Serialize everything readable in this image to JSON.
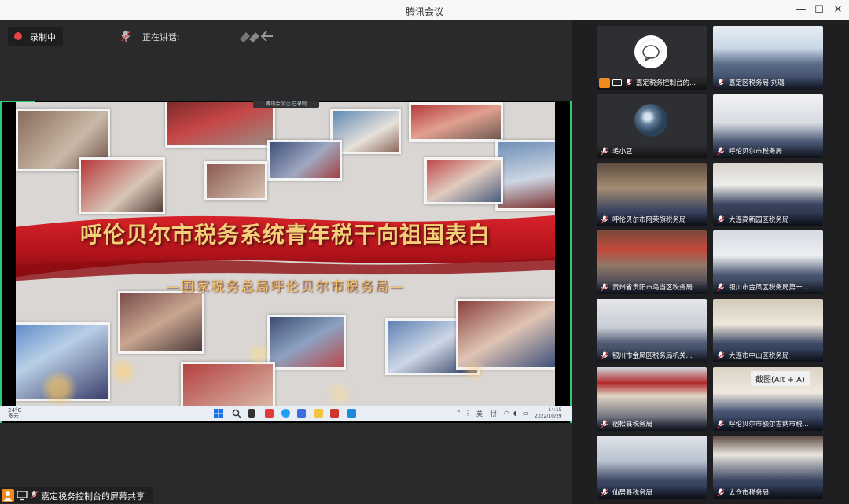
{
  "window": {
    "title": "腾讯会议"
  },
  "toolbar": {
    "recording_label": "录制中",
    "speaking_label": "正在讲话:"
  },
  "share": {
    "banner_title": "呼伦贝尔市税务系统青年税干向祖国表白",
    "banner_subtitle": "—国家税务总局呼伦贝尔市税务局—",
    "remote_bar_text": "腾讯会议 ▢ 已录制",
    "taskbar": {
      "weather_temp": "24°C",
      "weather_text": "多云",
      "ime_lang": "英",
      "ime_mode": "拼",
      "clock_time": "14:15",
      "clock_date": "2022/10/29"
    }
  },
  "bottom_bar": {
    "share_label": "嘉定税务控制台的屏幕共享"
  },
  "participants": [
    {
      "name": "嘉定税务控制台的...",
      "type": "avatar"
    },
    {
      "name": "嘉定区税务局 刘璐",
      "type": "room"
    },
    {
      "name": "毛小豆",
      "type": "avatar"
    },
    {
      "name": "呼伦贝尔市税务局",
      "type": "room"
    },
    {
      "name": "呼伦贝尔市阿荣旗税务局",
      "type": "room"
    },
    {
      "name": "大连高新园区税务局",
      "type": "room"
    },
    {
      "name": "贵州省贵阳市乌当区税务局",
      "type": "room"
    },
    {
      "name": "银川市金凤区税务局第一...",
      "type": "room"
    },
    {
      "name": "银川市金凤区税务局机关...",
      "type": "room"
    },
    {
      "name": "大连市中山区税务局",
      "type": "room"
    },
    {
      "name": "宿松县税务局",
      "type": "room"
    },
    {
      "name": "呼伦贝尔市额尔古纳市税...",
      "type": "room"
    },
    {
      "name": "仙居县税务局",
      "type": "room"
    },
    {
      "name": "太仓市税务局",
      "type": "room"
    }
  ],
  "tooltip": {
    "text": "截图(Alt + A)"
  },
  "colors": {
    "accent_green": "#2ecc71",
    "record_red": "#e84343",
    "banner_red": "#c0161d",
    "banner_gold": "#f4d07a"
  }
}
